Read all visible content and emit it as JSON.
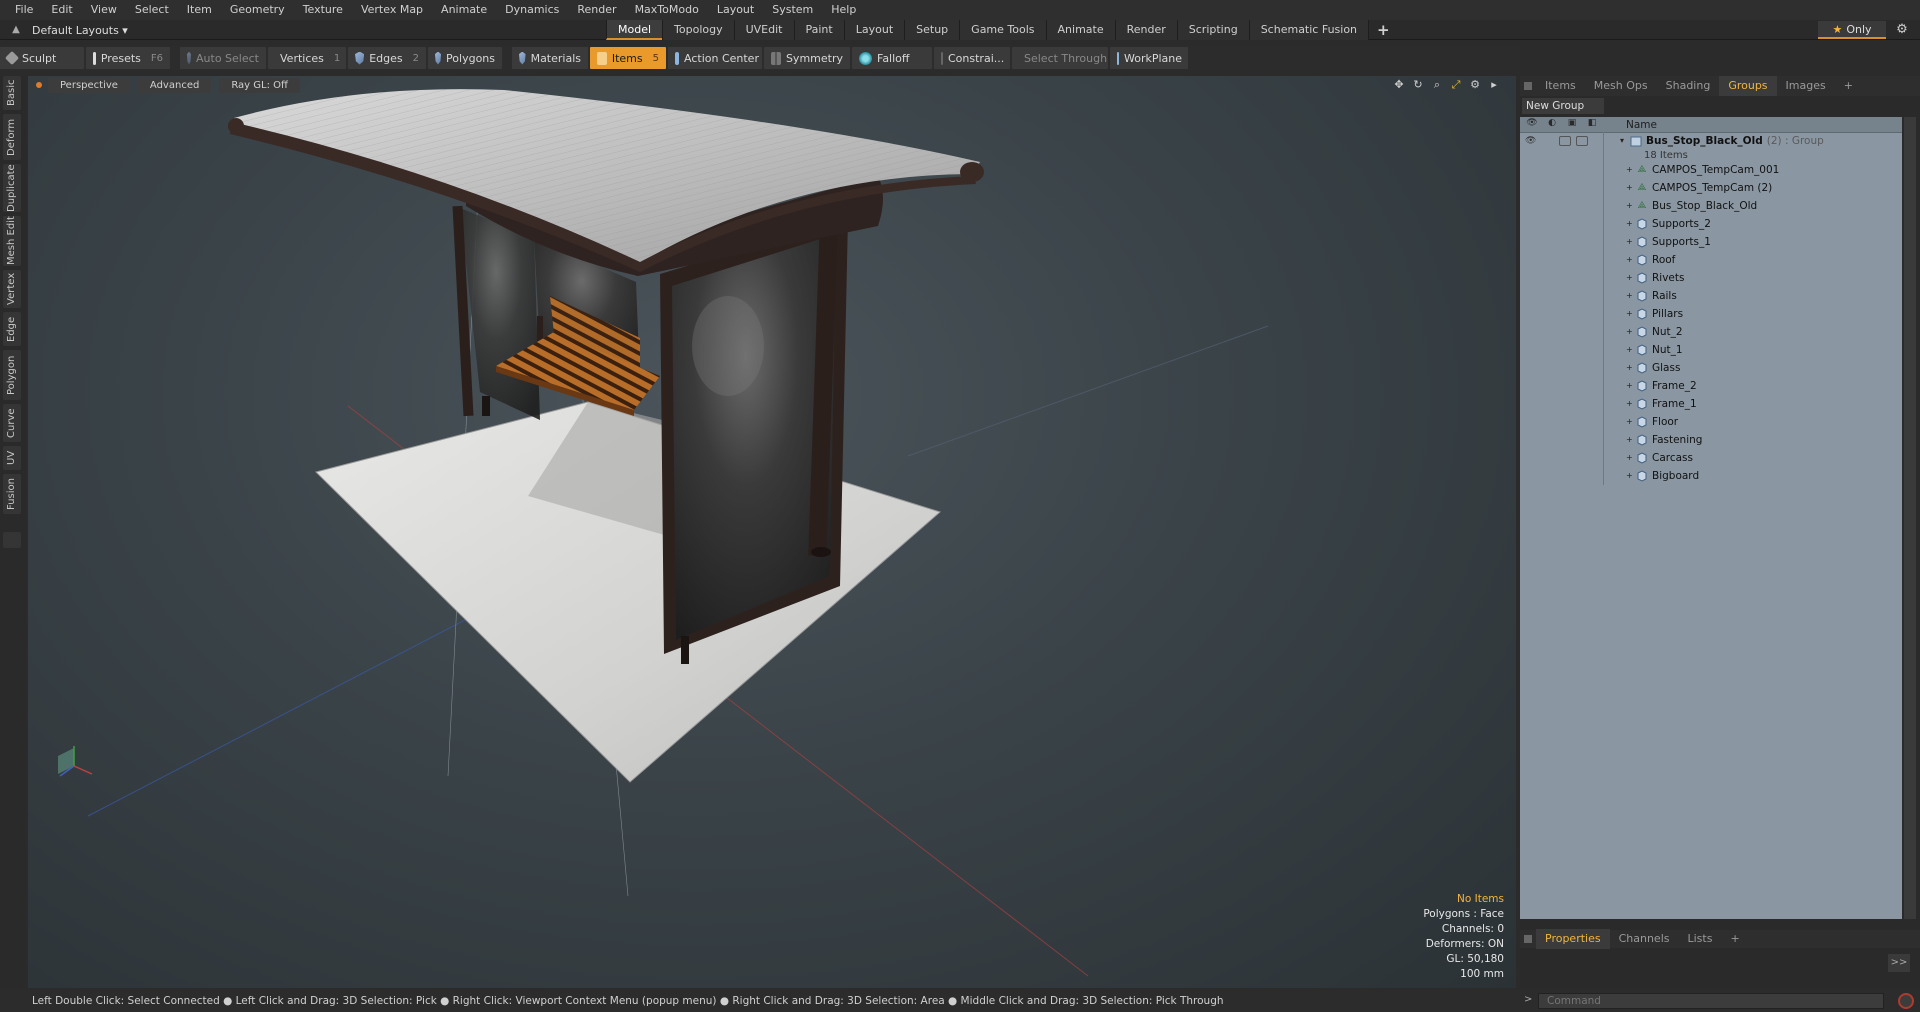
{
  "menu": [
    "File",
    "Edit",
    "View",
    "Select",
    "Item",
    "Geometry",
    "Texture",
    "Vertex Map",
    "Animate",
    "Dynamics",
    "Render",
    "MaxToModo",
    "Layout",
    "System",
    "Help"
  ],
  "layouts_label": "Default Layouts ▾",
  "mode_tabs": [
    "Model",
    "Topology",
    "UVEdit",
    "Paint",
    "Layout",
    "Setup",
    "Game Tools",
    "Animate",
    "Render",
    "Scripting",
    "Schematic Fusion"
  ],
  "active_mode_tab": "Model",
  "only_label": "Only",
  "toolbar": {
    "sculpt": "Sculpt",
    "presets": "Presets",
    "presets_key": "F6",
    "auto_select": "Auto Select",
    "vertices": "Vertices",
    "vertices_key": "1",
    "edges": "Edges",
    "edges_key": "2",
    "polygons": "Polygons",
    "materials": "Materials",
    "items": "Items",
    "items_key": "5",
    "action_center": "Action Center",
    "symmetry": "Symmetry",
    "falloff": "Falloff",
    "constraints": "Constrai...",
    "select_through": "Select Through",
    "workplane": "WorkPlane"
  },
  "left_tabs": [
    "Basic",
    "Deform",
    "Duplicate",
    "Mesh Edit",
    "Vertex",
    "Edge",
    "Polygon",
    "Curve",
    "UV",
    "Fusion"
  ],
  "viewport": {
    "view_label": "Perspective",
    "advanced_label": "Advanced",
    "raygl_label": "Ray GL: Off",
    "info": {
      "selection": "No Items",
      "polygons": "Polygons : Face",
      "channels": "Channels: 0",
      "deformers": "Deformers: ON",
      "gl": "GL: 50,180",
      "scale": "100 mm"
    }
  },
  "right_panel": {
    "tabs": [
      "Items",
      "Mesh Ops",
      "Shading",
      "Groups",
      "Images"
    ],
    "active_tab": "Groups",
    "new_group": "New Group",
    "name_header": "Name",
    "group": {
      "name": "Bus_Stop_Black_Old",
      "suffix": "(2) : Group",
      "count": "18 Items"
    },
    "items": [
      {
        "name": "CAMPOS_TempCam_001",
        "icon": "camera-icon"
      },
      {
        "name": "CAMPOS_TempCam (2)",
        "icon": "camera-icon"
      },
      {
        "name": "Bus_Stop_Black_Old",
        "icon": "camera-icon"
      },
      {
        "name": "Supports_2",
        "icon": "mesh-icon"
      },
      {
        "name": "Supports_1",
        "icon": "mesh-icon"
      },
      {
        "name": "Roof",
        "icon": "mesh-icon"
      },
      {
        "name": "Rivets",
        "icon": "mesh-icon"
      },
      {
        "name": "Rails",
        "icon": "mesh-icon"
      },
      {
        "name": "Pillars",
        "icon": "mesh-icon"
      },
      {
        "name": "Nut_2",
        "icon": "mesh-icon"
      },
      {
        "name": "Nut_1",
        "icon": "mesh-icon"
      },
      {
        "name": "Glass",
        "icon": "mesh-icon"
      },
      {
        "name": "Frame_2",
        "icon": "mesh-icon"
      },
      {
        "name": "Frame_1",
        "icon": "mesh-icon"
      },
      {
        "name": "Floor",
        "icon": "mesh-icon"
      },
      {
        "name": "Fastening",
        "icon": "mesh-icon"
      },
      {
        "name": "Carcass",
        "icon": "mesh-icon"
      },
      {
        "name": "Bigboard",
        "icon": "mesh-icon"
      }
    ],
    "bottom_tabs": [
      "Properties",
      "Channels",
      "Lists"
    ],
    "active_bottom_tab": "Properties",
    "command_placeholder": "Command"
  },
  "status_bar": "Left Double Click: Select Connected ● Left Click and Drag: 3D Selection: Pick ● Right Click: Viewport Context Menu (popup menu) ● Right Click and Drag: 3D Selection: Area ● Middle Click and Drag: 3D Selection: Pick Through",
  "colors": {
    "accent": "#e99a2a",
    "highlight": "#f3b53c",
    "list_bg": "#8a97a2",
    "viewport_bg": "#3a4348"
  }
}
